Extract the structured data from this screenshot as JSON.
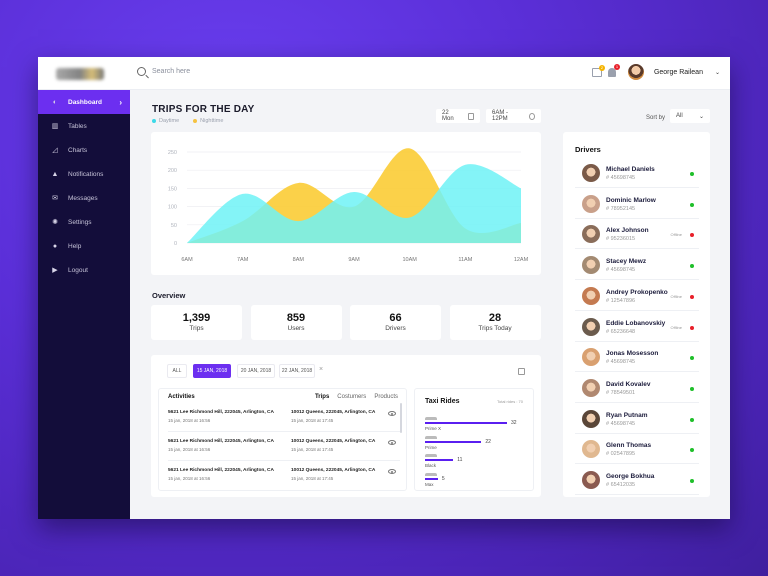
{
  "header": {
    "search_placeholder": "Search here",
    "user_name": "George Railean",
    "mail_badge": "2",
    "bell_badge": "1"
  },
  "sidebar": {
    "items": [
      {
        "label": "Dashboard",
        "icon": "dashboard-icon",
        "active": true
      },
      {
        "label": "Tables",
        "icon": "tables-icon"
      },
      {
        "label": "Charts",
        "icon": "charts-icon"
      },
      {
        "label": "Notifications",
        "icon": "bell-icon"
      },
      {
        "label": "Messages",
        "icon": "mail-icon"
      },
      {
        "label": "Settings",
        "icon": "gear-icon"
      },
      {
        "label": "Help",
        "icon": "help-icon"
      },
      {
        "label": "Logout",
        "icon": "logout-icon"
      }
    ]
  },
  "trips": {
    "title": "TRIPS FOR THE DAY",
    "legend": [
      {
        "label": "Daytime",
        "color": "#3dd9e8"
      },
      {
        "label": "Nighttime",
        "color": "#f5c242"
      }
    ],
    "date": "22 Mon",
    "time_range": "6AM - 12PM"
  },
  "sort": {
    "label": "Sort by",
    "value": "All"
  },
  "chart_data": {
    "type": "area",
    "x": [
      "6AM",
      "7AM",
      "8AM",
      "9AM",
      "10AM",
      "11AM",
      "12AM"
    ],
    "yticks": [
      0,
      50,
      100,
      150,
      200,
      250
    ],
    "ylim": [
      0,
      250
    ],
    "series": [
      {
        "name": "Daytime",
        "color": "#6ef2f6",
        "values": [
          0,
          135,
          60,
          140,
          70,
          215,
          150
        ]
      },
      {
        "name": "Nighttime",
        "color": "#fbcc35",
        "values": [
          0,
          60,
          165,
          100,
          260,
          40,
          55
        ]
      }
    ]
  },
  "overview": {
    "title": "Overview",
    "stats": [
      {
        "value": "1,399",
        "label": "Trips"
      },
      {
        "value": "859",
        "label": "Users"
      },
      {
        "value": "66",
        "label": "Drivers"
      },
      {
        "value": "28",
        "label": "Trips Today"
      }
    ]
  },
  "filters": {
    "tabs": [
      "ALL",
      "15 JAN, 2018",
      "20 JAN, 2018",
      "22 JAN, 2018"
    ],
    "close": "×"
  },
  "activities": {
    "title": "Activities",
    "tabs": [
      "Trips",
      "Costumers",
      "Products"
    ],
    "rows": [
      {
        "from": "5621 Lee Richmond Hill, 222045, Arlington, CA",
        "from_time": "15 jan, 2018 at 16:56",
        "to": "10012 Queens, 222045, Arlington, CA",
        "to_time": "15 jan, 2018 at 17:45"
      },
      {
        "from": "5621 Lee Richmond Hill, 222045, Arlington, CA",
        "from_time": "15 jan, 2018 at 16:56",
        "to": "10012 Queens, 222045, Arlington, CA",
        "to_time": "15 jan, 2018 at 17:45"
      },
      {
        "from": "5621 Lee Richmond Hill, 222045, Arlington, CA",
        "from_time": "15 jan, 2018 at 16:56",
        "to": "10012 Queens, 222045, Arlington, CA",
        "to_time": "15 jan, 2018 at 17:45"
      }
    ]
  },
  "taxi_rides": {
    "title": "Taxi Rides",
    "total": "Total rides : 70",
    "items": [
      {
        "name": "Prime X",
        "value": 32
      },
      {
        "name": "Prime",
        "value": 22
      },
      {
        "name": "Black",
        "value": 11
      },
      {
        "name": "Max",
        "value": 5
      }
    ]
  },
  "drivers": {
    "title": "Drivers",
    "offline_label": "Offline",
    "list": [
      {
        "name": "Michael Daniels",
        "id": "# 45698745",
        "online": true
      },
      {
        "name": "Dominic Marlow",
        "id": "# 78952145",
        "online": true
      },
      {
        "name": "Alex Johnson",
        "id": "# 95236015",
        "online": false
      },
      {
        "name": "Stacey Mewz",
        "id": "# 45698745",
        "online": true
      },
      {
        "name": "Andrey Prokopenko",
        "id": "# 12547896",
        "online": false
      },
      {
        "name": "Eddie Lobanovskiy",
        "id": "# 65236648",
        "online": false
      },
      {
        "name": "Jonas Mosesson",
        "id": "# 45698745",
        "online": true
      },
      {
        "name": "David Kovalev",
        "id": "# 78549501",
        "online": true
      },
      {
        "name": "Ryan Putnam",
        "id": "# 45698745",
        "online": true
      },
      {
        "name": "Glenn Thomas",
        "id": "# 02547895",
        "online": true
      },
      {
        "name": "George Bokhua",
        "id": "# 65412035",
        "online": true
      }
    ]
  }
}
